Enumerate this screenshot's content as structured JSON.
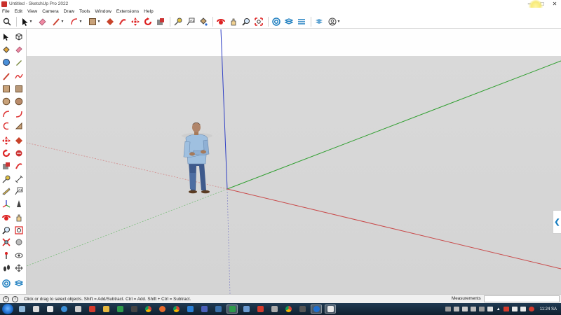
{
  "window": {
    "title": "Untitled - SketchUp Pro 2022",
    "controls": [
      "minimize",
      "maximize",
      "close"
    ]
  },
  "menu": [
    "File",
    "Edit",
    "View",
    "Camera",
    "Draw",
    "Tools",
    "Window",
    "Extensions",
    "Help"
  ],
  "toolbar": {
    "tools": [
      "search-icon",
      "select-icon",
      "eraser-icon",
      "line-icon",
      "arc-icon",
      "rectangle-icon",
      "push-pull-icon",
      "follow-me-icon",
      "move-icon",
      "rotate-icon",
      "scale-icon",
      "tape-measure-icon",
      "text-icon",
      "paint-bucket-icon",
      "orbit-icon",
      "pan-icon",
      "zoom-icon",
      "zoom-extents-icon",
      "warehouse-icon",
      "extension-warehouse-icon",
      "layout-icon",
      "extension-manager-icon",
      "account-icon"
    ]
  },
  "left_toolbar": {
    "tools": [
      "select-icon",
      "component-icon",
      "paint-bucket-icon",
      "eraser-icon",
      "tag-icon",
      "paint-icon",
      "line-icon",
      "freehand-icon",
      "rectangle-icon",
      "rotated-rectangle-icon",
      "circle-icon",
      "polygon-icon",
      "arc-icon",
      "2-point-arc-icon",
      "3-point-arc-icon",
      "pie-icon",
      "move-icon",
      "push-pull-icon",
      "rotate-icon",
      "follow-me-icon",
      "scale-icon",
      "offset-icon",
      "tape-measure-icon",
      "dimension-icon",
      "protractor-icon",
      "text-icon",
      "axes-icon",
      "3d-text-icon",
      "orbit-icon",
      "pan-icon",
      "zoom-icon",
      "zoom-window-icon",
      "zoom-extents-icon",
      "previous-view-icon",
      "position-camera-icon",
      "look-around-icon",
      "walk-icon",
      "section-plane-icon",
      "warehouse-icon",
      "extension-warehouse-icon"
    ]
  },
  "status": {
    "hint": "Click or drag to select objects. Shift = Add/Subtract. Ctrl = Add. Shift + Ctrl = Subtract.",
    "measurements_label": "Measurements",
    "measurements_value": ""
  },
  "taskbar": {
    "apps": [
      "explorer",
      "file-manager",
      "word",
      "powerpoint",
      "edge",
      "settings",
      "pdf",
      "folder",
      "excel",
      "video",
      "calculator",
      "chrome",
      "firefox",
      "chrome-2",
      "photos",
      "teams",
      "sketchup-active",
      "store",
      "media",
      "app",
      "app-2",
      "app-3",
      "app-4",
      "sketchup"
    ],
    "clock": "11:24 SA"
  },
  "colors": {
    "axis_red": "#c94a4a",
    "axis_green": "#2e9e2e",
    "axis_blue": "#2f3fc4",
    "sky": "#fefefe",
    "ground": "#d6d6d6"
  }
}
